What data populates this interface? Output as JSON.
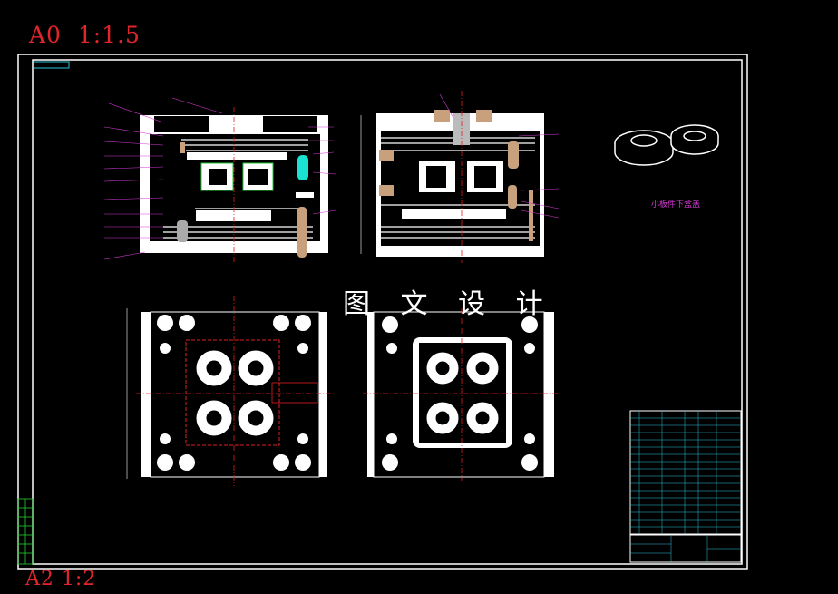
{
  "sheet": {
    "scale_top": "A0  1:1.5",
    "scale_bottom": "A2 1:2",
    "watermark": "图 文 设 计",
    "part_caption": "小板件下盒盖"
  },
  "colors": {
    "background": "#000000",
    "frame": "#ffffff",
    "scale_text": "#e0262a",
    "centerline": "#e02020",
    "annotation": "#d43ad4",
    "runner": "#19e2d2",
    "guide_pin": "#c8a07c",
    "dim_green": "#22cc33",
    "title_block": "#2cc0d8"
  },
  "icons": [
    "section-view-icon",
    "plan-view-icon",
    "part-3d-icon",
    "bom-table-icon",
    "title-block-icon"
  ]
}
